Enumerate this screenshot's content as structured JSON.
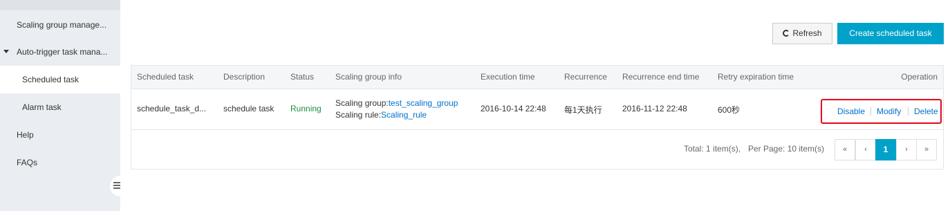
{
  "sidebar": {
    "items": [
      {
        "label": "Scaling group manage..."
      },
      {
        "label": "Auto-trigger task mana..."
      },
      {
        "label": "Scheduled task"
      },
      {
        "label": "Alarm task"
      },
      {
        "label": "Help"
      },
      {
        "label": "FAQs"
      }
    ]
  },
  "toolbar": {
    "refresh_label": "Refresh",
    "create_label": "Create scheduled task"
  },
  "table": {
    "headers": [
      "Scheduled task",
      "Description",
      "Status",
      "Scaling group info",
      "Execution time",
      "Recurrence",
      "Recurrence end time",
      "Retry expiration time",
      "Operation"
    ],
    "rows": [
      {
        "task": "schedule_task_d...",
        "description": "schedule task",
        "status": "Running",
        "group_label": "Scaling group:",
        "group_value": "test_scaling_group",
        "rule_label": "Scaling rule:",
        "rule_value": "Scaling_rule",
        "execution_time": "2016-10-14 22:48",
        "recurrence": "每1天执行",
        "recurrence_end": "2016-11-12 22:48",
        "retry_expiration": "600秒",
        "ops": {
          "disable": "Disable",
          "modify": "Modify",
          "delete": "Delete"
        }
      }
    ]
  },
  "pagination": {
    "total": "Total: 1 item(s),",
    "per_page": "Per Page: 10 item(s)",
    "first": "«",
    "prev": "‹",
    "current": "1",
    "next": "›",
    "last": "»"
  },
  "colors": {
    "primary": "#00a2ca",
    "link": "#0070cc",
    "status_running": "#1e8e3e",
    "highlight_box": "#e4061a"
  }
}
